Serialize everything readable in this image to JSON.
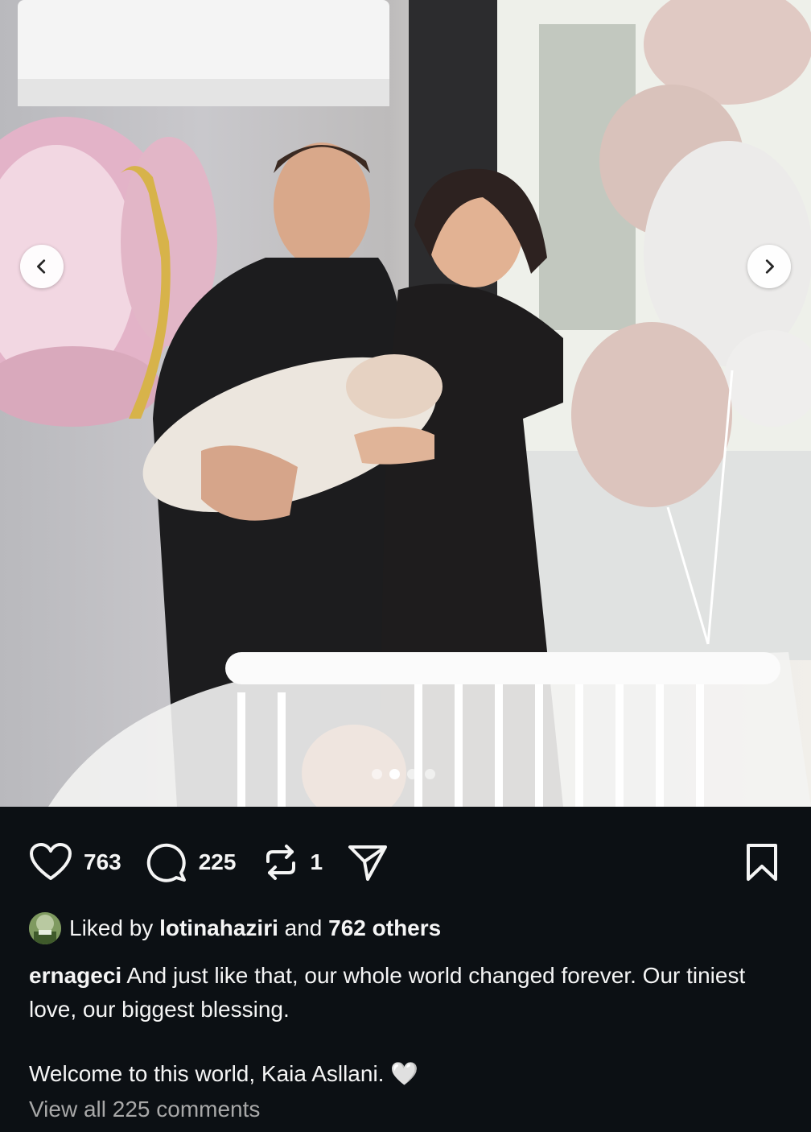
{
  "post": {
    "photo_alt": "",
    "carousel": {
      "total": 4,
      "active_index": 1
    },
    "prev_icon": "chevron-left-icon",
    "next_icon": "chevron-right-icon"
  },
  "actions": {
    "like_count": "763",
    "comment_count": "225",
    "repost_count": "1",
    "icons": [
      "heart-icon",
      "comment-icon",
      "repost-icon",
      "share-icon",
      "bookmark-icon"
    ]
  },
  "liked_by": {
    "prefix": "Liked by ",
    "user": "lotinahaziri",
    "middle": " and ",
    "others": "762 others"
  },
  "caption": {
    "username": "ernageci",
    "text": " And just like that, our whole world changed forever. Our tiniest love, our biggest blessing.",
    "second_paragraph": "Welcome to this world, Kaia Asllani. 🤍"
  },
  "view_comments": "View all 225 comments",
  "colors": {
    "background": "#0c1014",
    "text": "#f5f5f5",
    "muted": "#a8a8a8"
  }
}
